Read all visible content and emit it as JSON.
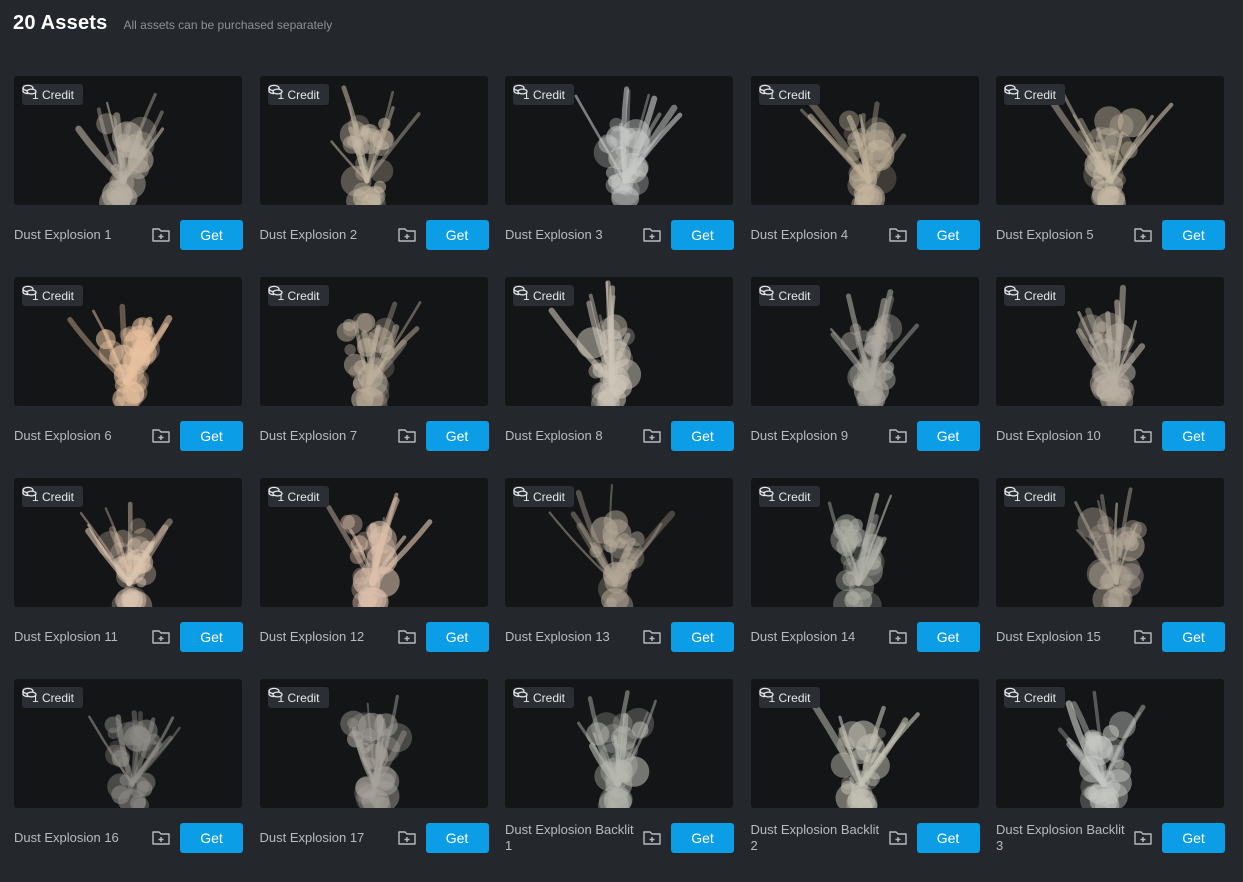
{
  "header": {
    "title": "20 Assets",
    "subtitle": "All assets can be purchased separately"
  },
  "assets": [
    {
      "name": "Dust Explosion 1",
      "credit": "1 Credit",
      "get": "Get",
      "tint": "#b8b0a2"
    },
    {
      "name": "Dust Explosion 2",
      "credit": "1 Credit",
      "get": "Get",
      "tint": "#c4b7a3"
    },
    {
      "name": "Dust Explosion 3",
      "credit": "1 Credit",
      "get": "Get",
      "tint": "#c8cac8"
    },
    {
      "name": "Dust Explosion 4",
      "credit": "1 Credit",
      "get": "Get",
      "tint": "#c2b49d"
    },
    {
      "name": "Dust Explosion 5",
      "credit": "1 Credit",
      "get": "Get",
      "tint": "#c7baa5"
    },
    {
      "name": "Dust Explosion 6",
      "credit": "1 Credit",
      "get": "Get",
      "tint": "#e8c2a0"
    },
    {
      "name": "Dust Explosion 7",
      "credit": "1 Credit",
      "get": "Get",
      "tint": "#bcae9b"
    },
    {
      "name": "Dust Explosion 8",
      "credit": "1 Credit",
      "get": "Get",
      "tint": "#cec6b8"
    },
    {
      "name": "Dust Explosion 9",
      "credit": "1 Credit",
      "get": "Get",
      "tint": "#aeaba2"
    },
    {
      "name": "Dust Explosion 10",
      "credit": "1 Credit",
      "get": "Get",
      "tint": "#b9b0a3"
    },
    {
      "name": "Dust Explosion 11",
      "credit": "1 Credit",
      "get": "Get",
      "tint": "#ddc6b0"
    },
    {
      "name": "Dust Explosion 12",
      "credit": "1 Credit",
      "get": "Get",
      "tint": "#dcc0ab"
    },
    {
      "name": "Dust Explosion 13",
      "credit": "1 Credit",
      "get": "Get",
      "tint": "#b2a796"
    },
    {
      "name": "Dust Explosion 14",
      "credit": "1 Credit",
      "get": "Get",
      "tint": "#b1b2a9"
    },
    {
      "name": "Dust Explosion 15",
      "credit": "1 Credit",
      "get": "Get",
      "tint": "#b5aa9a"
    },
    {
      "name": "Dust Explosion 16",
      "credit": "1 Credit",
      "get": "Get",
      "tint": "#8f8d88"
    },
    {
      "name": "Dust Explosion 17",
      "credit": "1 Credit",
      "get": "Get",
      "tint": "#a7a39c"
    },
    {
      "name": "Dust Explosion Backlit 1",
      "credit": "1 Credit",
      "get": "Get",
      "tint": "#b7b8b0"
    },
    {
      "name": "Dust Explosion Backlit 2",
      "credit": "1 Credit",
      "get": "Get",
      "tint": "#c3c1b4"
    },
    {
      "name": "Dust Explosion Backlit 3",
      "credit": "1 Credit",
      "get": "Get",
      "tint": "#c4c7c2"
    }
  ],
  "icons": {
    "credit": "coin-stack-icon",
    "collection": "folder-plus-icon"
  },
  "colors": {
    "accent": "#0b9de6",
    "background": "#24282c",
    "thumbnail_bg": "#131516"
  }
}
